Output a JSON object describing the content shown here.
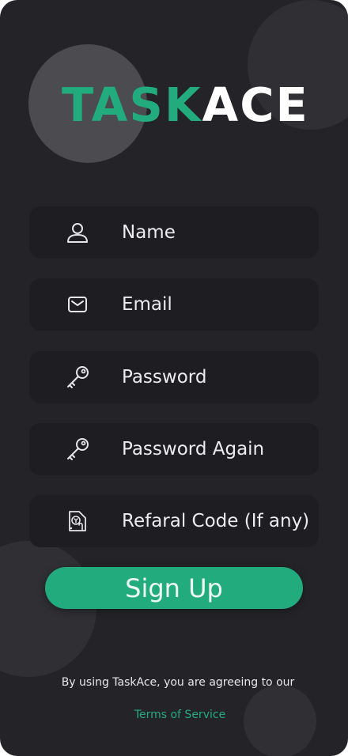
{
  "brand": {
    "name_part_1": "TASK",
    "name_part_2": "ACE",
    "accent_color": "#22ab7d"
  },
  "form": {
    "fields": [
      {
        "placeholder": "Name",
        "icon": "user-icon"
      },
      {
        "placeholder": "Email",
        "icon": "mail-icon"
      },
      {
        "placeholder": "Password",
        "icon": "key-icon"
      },
      {
        "placeholder": "Password Again",
        "icon": "key-icon"
      },
      {
        "placeholder": "Refaral Code (If any)",
        "icon": "referral-icon"
      }
    ],
    "submit_label": "Sign Up"
  },
  "footer": {
    "agreement_text": "By using TaskAce, you are agreeing to our",
    "terms_link": "Terms of Service"
  }
}
